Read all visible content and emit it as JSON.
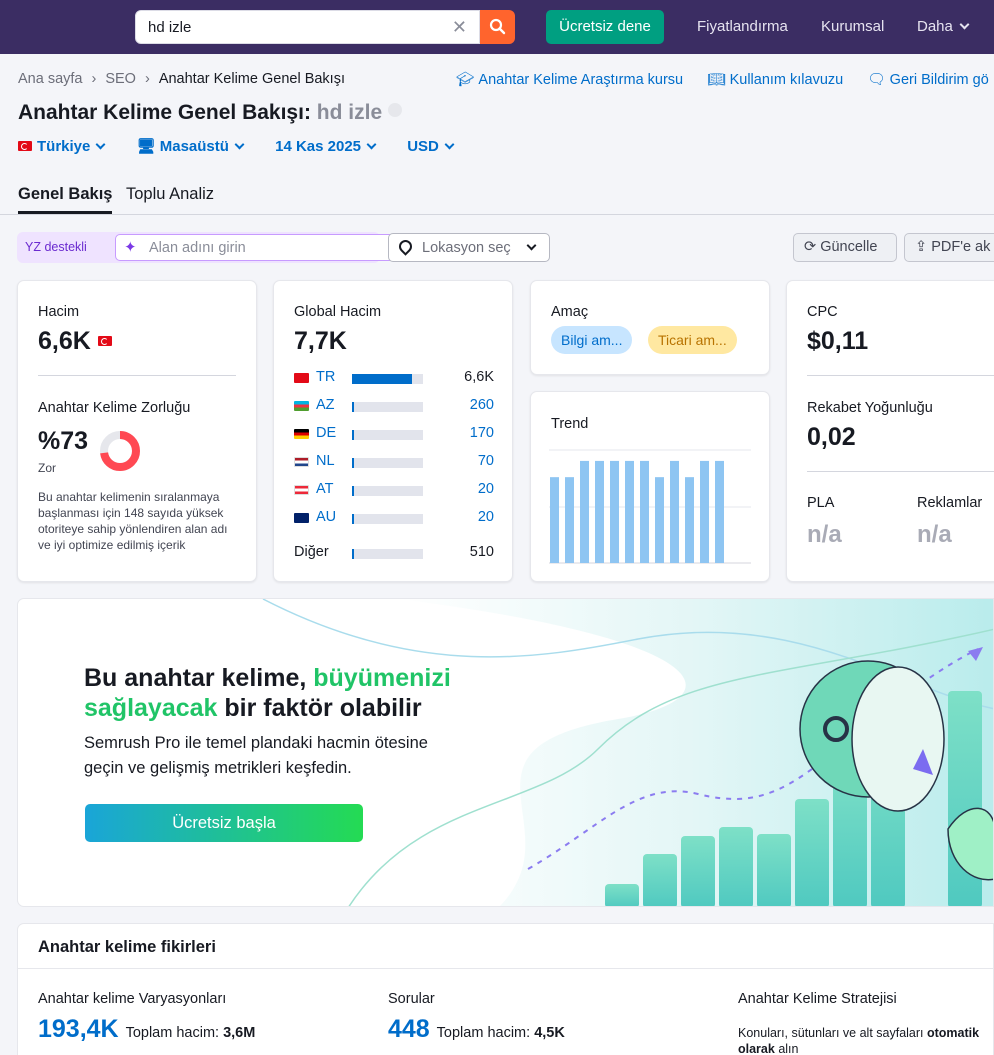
{
  "topbar": {
    "search_value": "hd izle",
    "trial_button": "Ücretsiz dene",
    "nav": [
      "Fiyatlandırma",
      "Kurumsal",
      "Daha"
    ]
  },
  "breadcrumb": [
    "Ana sayfa",
    "SEO",
    "Anahtar Kelime Genel Bakışı"
  ],
  "help_links": [
    "Anahtar Kelime Araştırma kursu",
    "Kullanım kılavuzu",
    "Geri Bildirim gö"
  ],
  "title": {
    "prefix": "Anahtar Kelime Genel Bakışı:",
    "keyword": "hd izle"
  },
  "filters": {
    "country": "Türkiye",
    "device": "Masaüstü",
    "date": "14 Kas 2025",
    "currency": "USD"
  },
  "tabs": [
    "Genel Bakış",
    "Toplu Analiz"
  ],
  "ai_row": {
    "tag": "YZ destekli",
    "domain_placeholder": "Alan adını girin",
    "location_placeholder": "Lokasyon seç",
    "update_button": "Güncelle",
    "pdf_button": "PDF'e ak"
  },
  "volume": {
    "label": "Hacim",
    "value": "6,6K"
  },
  "difficulty": {
    "label": "Anahtar Kelime Zorluğu",
    "value": "%73",
    "level": "Zor",
    "percent": 73,
    "description": "Bu anahtar kelimenin sıralanmaya başlanması için 148 sayıda yüksek otoriteye sahip yönlendiren alan adı ve iyi optimize edilmiş içerik"
  },
  "global_volume": {
    "label": "Global Hacim",
    "value": "7,7K",
    "countries": [
      {
        "code": "TR",
        "value": "6,6K",
        "share": 0.85
      },
      {
        "code": "AZ",
        "value": "260",
        "share": 0.03
      },
      {
        "code": "DE",
        "value": "170",
        "share": 0.03
      },
      {
        "code": "NL",
        "value": "70",
        "share": 0.03
      },
      {
        "code": "AT",
        "value": "20",
        "share": 0.03
      },
      {
        "code": "AU",
        "value": "20",
        "share": 0.03
      }
    ],
    "other": {
      "label": "Diğer",
      "value": "510",
      "share": 0.03
    }
  },
  "intent": {
    "label": "Amaç",
    "pills": [
      "Bilgi am...",
      "Ticari am..."
    ]
  },
  "trend": {
    "label": "Trend",
    "values": [
      0.74,
      0.74,
      0.88,
      0.88,
      0.88,
      0.88,
      0.88,
      0.74,
      0.88,
      0.74,
      0.88,
      0.88
    ]
  },
  "cpc": {
    "label": "CPC",
    "value": "$0,11"
  },
  "competition": {
    "label": "Rekabet Yoğunluğu",
    "value": "0,02"
  },
  "pla": {
    "label": "PLA",
    "value": "n/a"
  },
  "ads": {
    "label": "Reklamlar",
    "value": "n/a"
  },
  "banner": {
    "title_part1": "Bu anahtar kelime, ",
    "title_highlight1": "büyümenizi",
    "title_highlight2": "sağlayacak",
    "title_part2": " bir faktör olabilir",
    "subtitle": "Semrush Pro ile temel plandaki hacmin ötesine geçin ve gelişmiş metrikleri keşfedin.",
    "button": "Ücretsiz başla"
  },
  "ideas": {
    "title": "Anahtar kelime fikirleri",
    "variations": {
      "label": "Anahtar kelime Varyasyonları",
      "count": "193,4K",
      "total_label": "Toplam hacim:",
      "total": "3,6M"
    },
    "questions": {
      "label": "Sorular",
      "count": "448",
      "total_label": "Toplam hacim:",
      "total": "4,5K"
    },
    "strategy": {
      "label": "Anahtar Kelime Stratejisi",
      "text_start": "Konuları, sütunları ve alt sayfaları ",
      "text_bold": "otomatik olarak",
      "text_end": " alın"
    }
  },
  "colors": {
    "brand_nav": "#3b2d63",
    "accent_blue": "#006dca",
    "search_orange": "#ff642d",
    "trial_green": "#009f81",
    "difficulty_red": "#ff4953"
  }
}
